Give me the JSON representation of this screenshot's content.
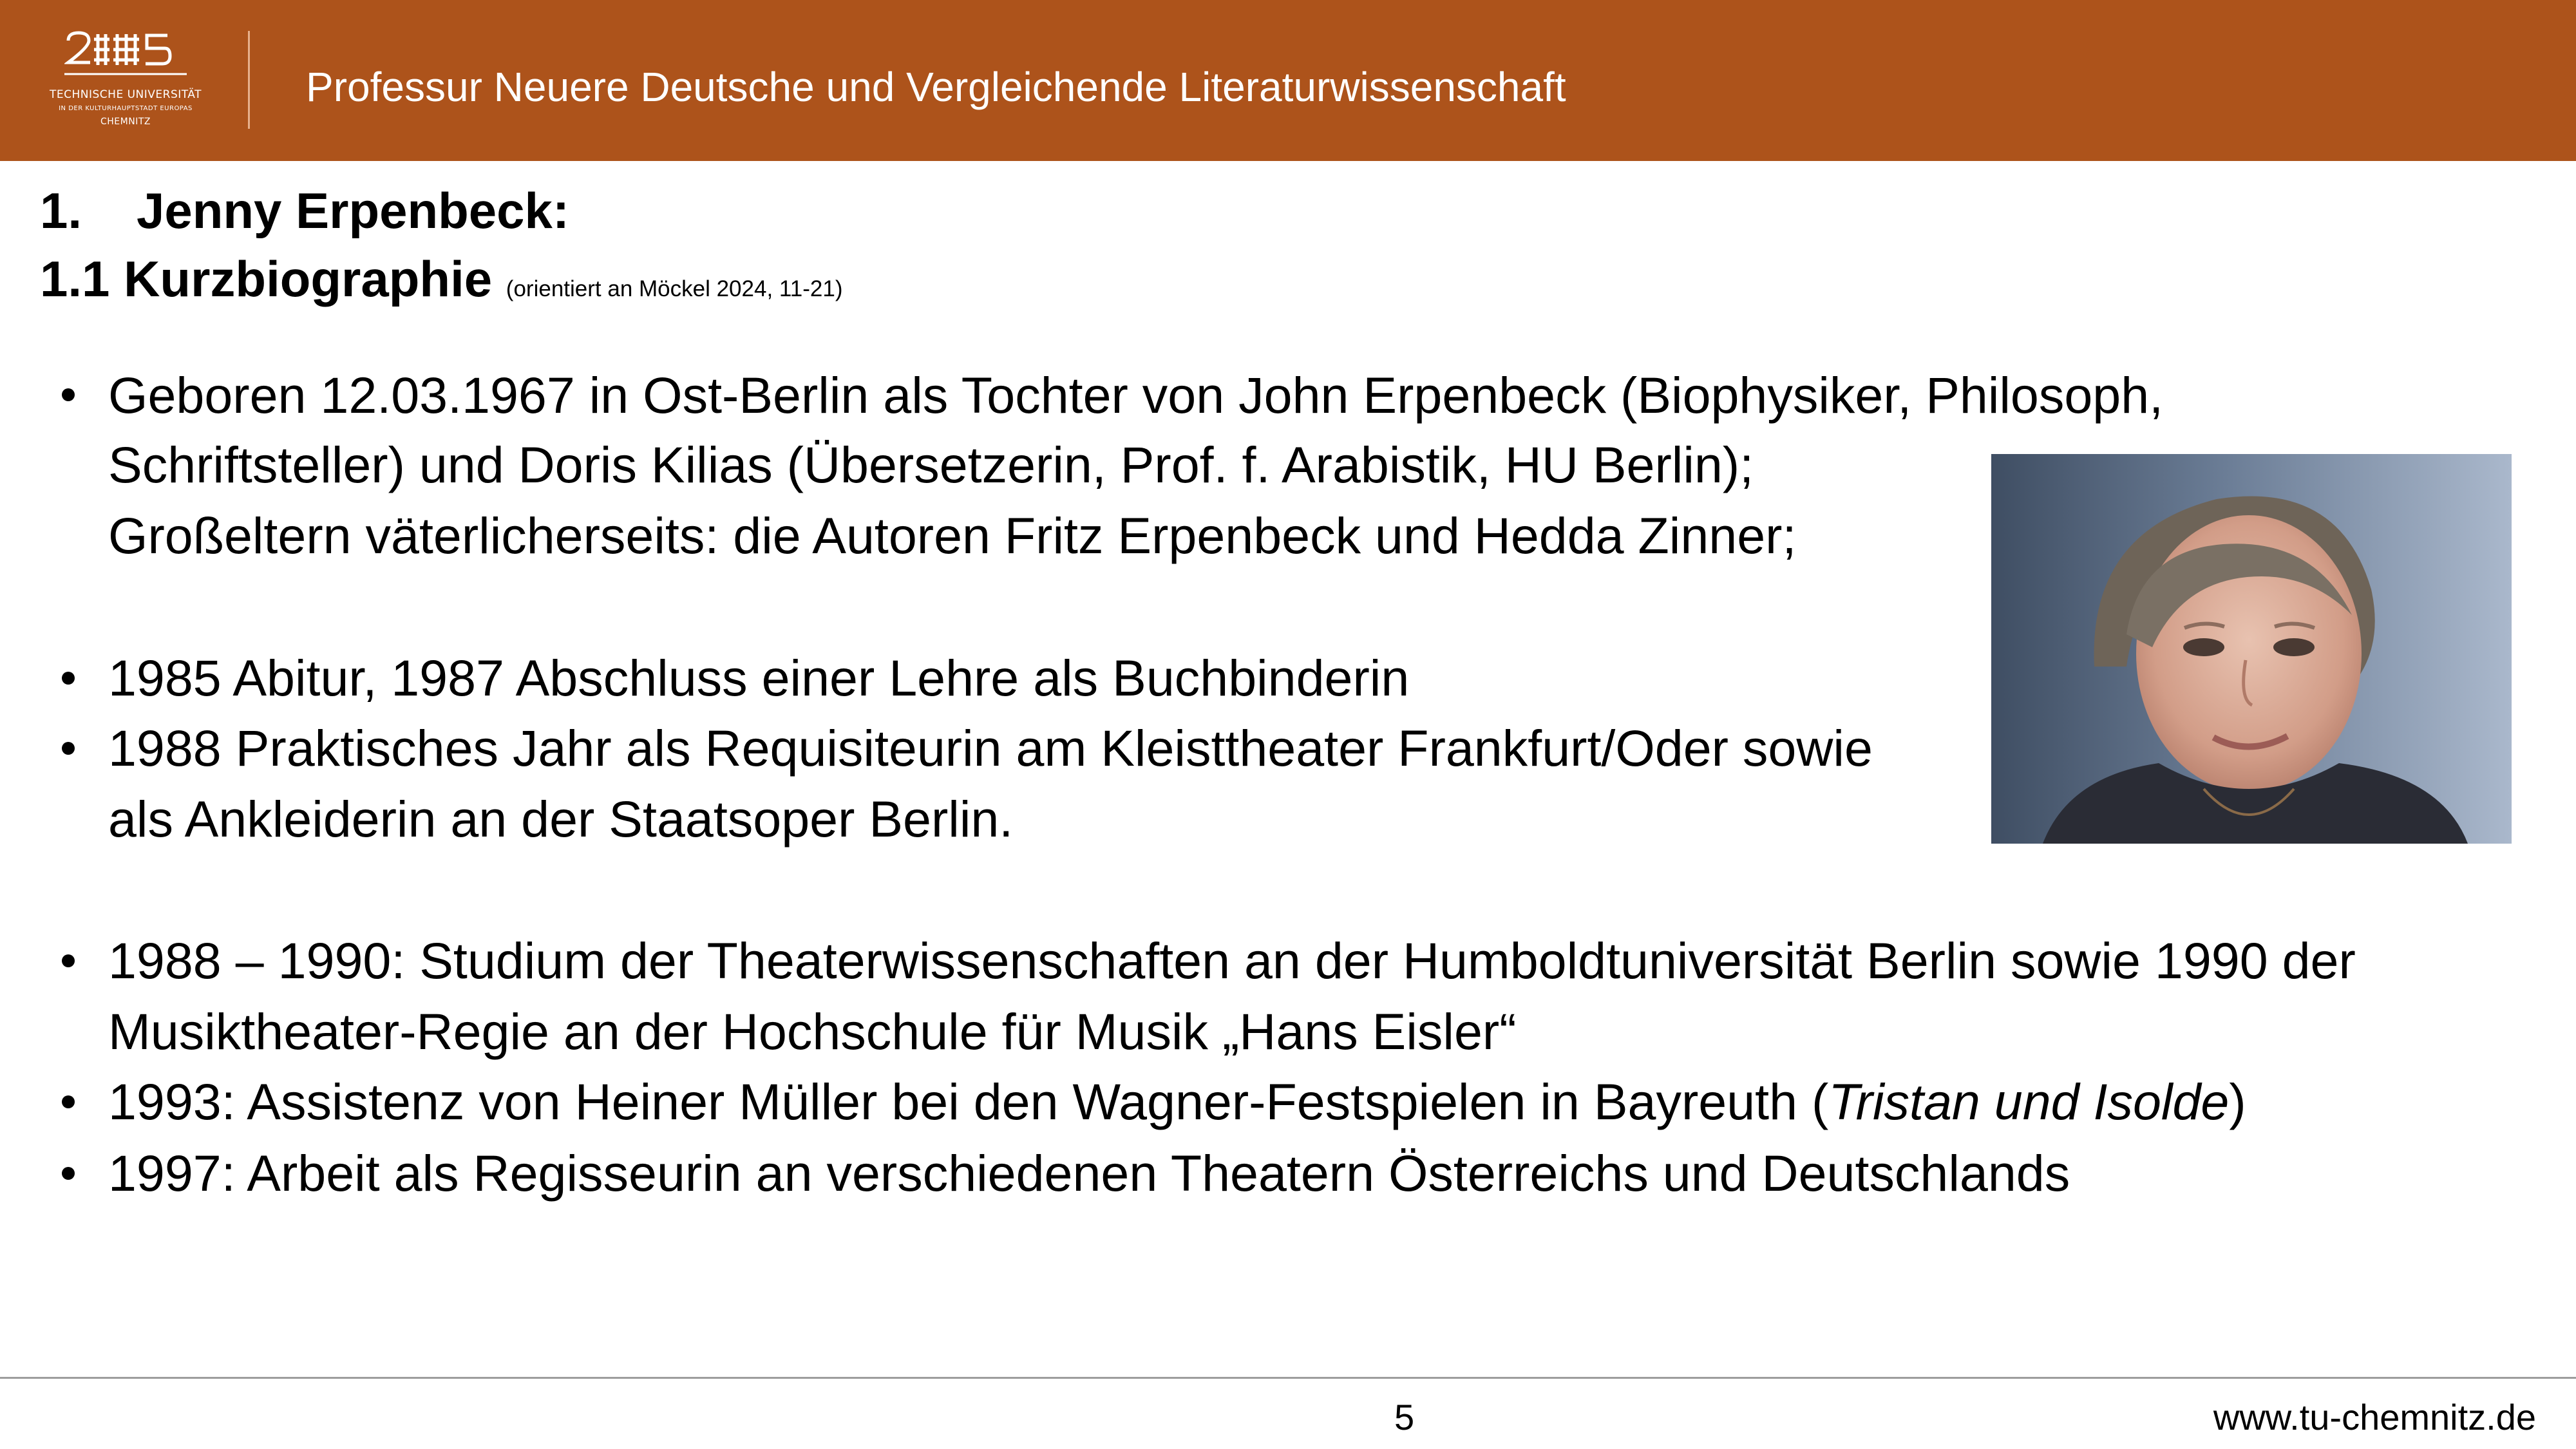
{
  "header": {
    "logo_line1": "TECHNISCHE UNIVERSITÄT",
    "logo_line2": "IN DER KULTURHAUPTSTADT EUROPAS",
    "logo_line3": "CHEMNITZ",
    "title": "Professur Neuere Deutsche und Vergleichende Literaturwissenschaft",
    "color": "#ad531b"
  },
  "heading": {
    "number": "1.",
    "title": "Jenny Erpenbeck:",
    "subtitle": "1.1 Kurzbiographie",
    "source": "(orientiert an Möckel 2024, 11-21)"
  },
  "bullets": [
    {
      "lines": [
        "Geboren 12.03.1967 in Ost-Berlin als Tochter von John Erpenbeck (Biophysiker, Philosoph,",
        "Schriftsteller) und Doris Kilias (Übersetzerin, Prof. f. Arabistik, HU Berlin);",
        "Großeltern väterlicherseits: die Autoren Fritz Erpenbeck und Hedda Zinner;"
      ]
    },
    {
      "lines": [
        "1985 Abitur, 1987 Abschluss einer Lehre als Buchbinderin"
      ]
    },
    {
      "lines": [
        "1988 Praktisches Jahr als Requisiteurin am Kleisttheater Frankfurt/Oder sowie",
        "als Ankleiderin an der Staatsoper Berlin."
      ]
    },
    {
      "lines": [
        "1988 – 1990: Studium der Theaterwissenschaften an der Humboldtuniversität Berlin sowie 1990 der",
        "Musiktheater-Regie an der Hochschule für Musik „Hans Eisler“"
      ]
    },
    {
      "prefix": "1993: Assistenz von Heiner Müller bei den Wagner-Festspielen in Bayreuth (",
      "italic": "Tristan und Isolde",
      "suffix": ")"
    },
    {
      "lines": [
        "1997: Arbeit als Regisseurin an verschiedenen Theatern Österreichs und Deutschlands"
      ]
    }
  ],
  "footer": {
    "page": "5",
    "url": "www.tu-chemnitz.de"
  }
}
